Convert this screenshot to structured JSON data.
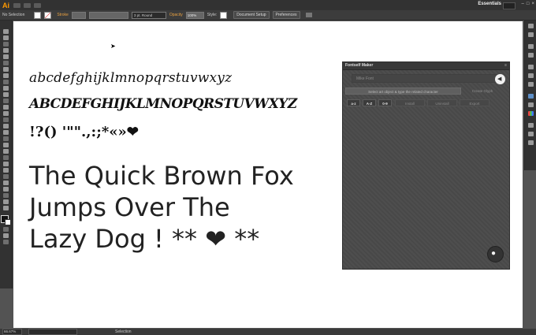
{
  "app": {
    "logo": "Ai",
    "workspace": "Essentials"
  },
  "control_bar": {
    "selection": "No Selection",
    "stroke_label": "Stroke",
    "brush": "3 pt. Round",
    "opacity_label": "Opacity",
    "opacity_value": "100%",
    "style_label": "Style:",
    "document_setup": "Document Setup",
    "preferences": "Preferences"
  },
  "canvas": {
    "lowercase": "abcdefghijklmnopqrstuvwxyz",
    "uppercase": "ABCDEFGHIJKLMNOPQRSTUVWXYZ",
    "punctuation": "!?() '\"\".,:;*«»❤",
    "sample_lines": [
      "The Quick Brown Fox",
      "Jumps Over The",
      "Lazy Dog ! ** ❤ **"
    ]
  },
  "panel": {
    "title": "Fontself Maker",
    "font_name_placeholder": "Mike Font",
    "select_button": "Select art object & type the related character",
    "create_button": "Create Glyph",
    "buttons": [
      "a-z",
      "A-Z",
      "0-9",
      "Install",
      "Uninstall",
      "Export"
    ]
  },
  "status": {
    "zoom": "66.67%",
    "tool": "Selection"
  }
}
